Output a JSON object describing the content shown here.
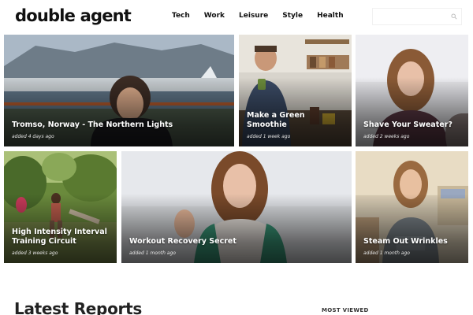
{
  "site": {
    "logo": "double agent"
  },
  "nav": [
    "Tech",
    "Work",
    "Leisure",
    "Style",
    "Health"
  ],
  "search": {
    "placeholder": ""
  },
  "tiles": [
    {
      "title": "Tromso, Norway - The Northern Lights",
      "meta": "added 4 days ago"
    },
    {
      "title": "Make a Green Smoothie",
      "meta": "added 1 week ago"
    },
    {
      "title": "Shave Your Sweater?",
      "meta": "added 2 weeks ago"
    },
    {
      "title": "High Intensity Interval Training Circuit",
      "meta": "added 3 weeks ago"
    },
    {
      "title": "Workout Recovery Secret",
      "meta": "added 1 month ago"
    },
    {
      "title": "Steam Out Wrinkles",
      "meta": "added 1 month ago"
    }
  ],
  "sections": {
    "latest": "Latest Reports",
    "most_viewed": "MOST VIEWED"
  },
  "icons": {
    "search": "search-icon"
  }
}
